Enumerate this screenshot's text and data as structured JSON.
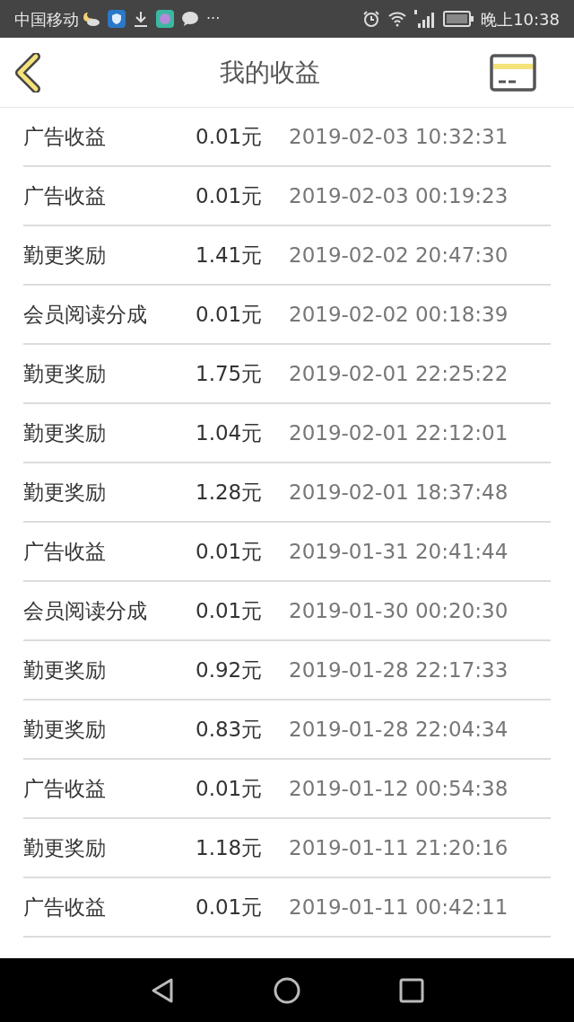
{
  "status_bar": {
    "carrier": "中国移动",
    "more": "···",
    "time": "晚上10:38"
  },
  "header": {
    "title": "我的收益"
  },
  "records": [
    {
      "type": "广告收益",
      "amount": "0.01元",
      "time": "2019-02-03 10:32:31"
    },
    {
      "type": "广告收益",
      "amount": "0.01元",
      "time": "2019-02-03 00:19:23"
    },
    {
      "type": "勤更奖励",
      "amount": "1.41元",
      "time": "2019-02-02 20:47:30"
    },
    {
      "type": "会员阅读分成",
      "amount": "0.01元",
      "time": "2019-02-02 00:18:39"
    },
    {
      "type": "勤更奖励",
      "amount": "1.75元",
      "time": "2019-02-01 22:25:22"
    },
    {
      "type": "勤更奖励",
      "amount": "1.04元",
      "time": "2019-02-01 22:12:01"
    },
    {
      "type": "勤更奖励",
      "amount": "1.28元",
      "time": "2019-02-01 18:37:48"
    },
    {
      "type": "广告收益",
      "amount": "0.01元",
      "time": "2019-01-31 20:41:44"
    },
    {
      "type": "会员阅读分成",
      "amount": "0.01元",
      "time": "2019-01-30 00:20:30"
    },
    {
      "type": "勤更奖励",
      "amount": "0.92元",
      "time": "2019-01-28 22:17:33"
    },
    {
      "type": "勤更奖励",
      "amount": "0.83元",
      "time": "2019-01-28 22:04:34"
    },
    {
      "type": "广告收益",
      "amount": "0.01元",
      "time": "2019-01-12 00:54:38"
    },
    {
      "type": "勤更奖励",
      "amount": "1.18元",
      "time": "2019-01-11 21:20:16"
    },
    {
      "type": "广告收益",
      "amount": "0.01元",
      "time": "2019-01-11 00:42:11"
    }
  ]
}
